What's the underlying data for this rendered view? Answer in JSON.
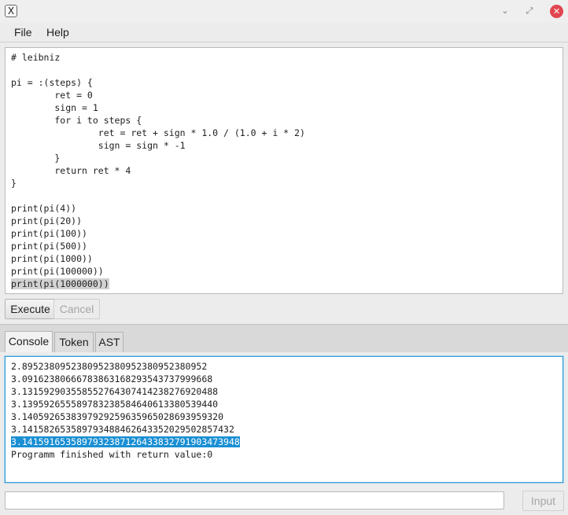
{
  "window": {
    "app_icon_glyph": "X",
    "minimize_glyph": "⌄",
    "maximize_glyph": "⤢",
    "close_glyph": "✕"
  },
  "menu": {
    "items": [
      {
        "label": "File"
      },
      {
        "label": "Help"
      }
    ]
  },
  "editor": {
    "lines": [
      "# leibniz",
      "",
      "pi = :(steps) {",
      "        ret = 0",
      "        sign = 1",
      "        for i to steps {",
      "                ret = ret + sign * 1.0 / (1.0 + i * 2)",
      "                sign = sign * -1",
      "        }",
      "        return ret * 4",
      "}",
      "",
      "print(pi(4))",
      "print(pi(20))",
      "print(pi(100))",
      "print(pi(500))",
      "print(pi(1000))",
      "print(pi(100000))",
      "print(pi(1000000))"
    ],
    "selected_line_index": 18
  },
  "buttons": {
    "execute": "Execute",
    "cancel": "Cancel",
    "input": "Input"
  },
  "tabs": [
    {
      "label": "Console",
      "active": true
    },
    {
      "label": "Token",
      "active": false
    },
    {
      "label": "AST",
      "active": false
    }
  ],
  "console": {
    "lines": [
      "2.8952380952380952380952380952380952",
      "3.0916238066678386316829354373799966 8",
      "3.1315929035585527643074142382769204 88",
      "3.1395926555897832385846406133805394 40",
      "3.1405926538397929259635965028693959 320",
      "3.1415826535897934884626433520295028 57432",
      "3.1415916535897932387126433832791903 473948",
      "Programm finished with return value: 0"
    ],
    "selected_line_index": 6
  },
  "input": {
    "value": "",
    "placeholder": ""
  },
  "colors": {
    "selection_console": "#1a8fd3",
    "selection_editor": "#d2d2d2",
    "close_button": "#e04650",
    "focus_border": "#3a9fd8"
  }
}
